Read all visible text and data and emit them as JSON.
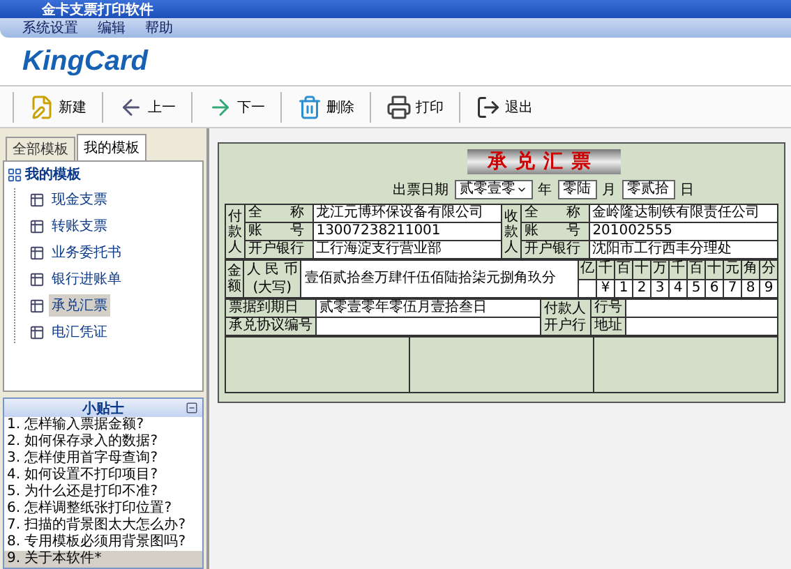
{
  "window": {
    "title": "金卡支票打印软件"
  },
  "menu": [
    {
      "label": "系统设置"
    },
    {
      "label": "编辑"
    },
    {
      "label": "帮助"
    }
  ],
  "logo": "KingCard",
  "toolbar": [
    {
      "label": "新建",
      "kind": "new"
    },
    {
      "label": "上一",
      "kind": "prev"
    },
    {
      "label": "下一",
      "kind": "next"
    },
    {
      "label": "删除",
      "kind": "delete"
    },
    {
      "label": "打印",
      "kind": "print"
    },
    {
      "label": "退出",
      "kind": "exit"
    }
  ],
  "tabs": [
    {
      "label": "全部模板",
      "selected": false
    },
    {
      "label": "我的模板",
      "selected": true
    }
  ],
  "tree": {
    "label": "我的模板",
    "children": [
      {
        "label": "现金支票",
        "selected": false
      },
      {
        "label": "转账支票",
        "selected": false
      },
      {
        "label": "业务委托书",
        "selected": false
      },
      {
        "label": "银行进账单",
        "selected": false
      },
      {
        "label": "承兑汇票",
        "selected": true
      },
      {
        "label": "电汇凭证",
        "selected": false
      }
    ]
  },
  "tips": {
    "title": "小贴士",
    "items": [
      {
        "text": "1. 怎样输入票据金额?",
        "selected": false
      },
      {
        "text": "2. 如何保存录入的数据?",
        "selected": false
      },
      {
        "text": "3. 怎样使用首字母查询?",
        "selected": false
      },
      {
        "text": "4. 如何设置不打印项目?",
        "selected": false
      },
      {
        "text": "5. 为什么还是打印不准?",
        "selected": false
      },
      {
        "text": "6. 怎样调整纸张打印位置?",
        "selected": false
      },
      {
        "text": "7. 扫描的背景图太大怎么办?",
        "selected": false
      },
      {
        "text": "8. 专用模板必须用背景图吗?",
        "selected": false
      },
      {
        "text": "9. 关于本软件*",
        "selected": true
      }
    ]
  },
  "form": {
    "title": "承兑汇票",
    "date": {
      "label": "出票日期",
      "year": "贰零壹零",
      "year_unit": "年",
      "month": "零陆",
      "month_unit": "月",
      "day": "零贰拾",
      "day_unit": "日"
    },
    "payer": {
      "label": "付款人",
      "rows": [
        {
          "label": "全　　称",
          "value": "龙江元博环保设备有限公司"
        },
        {
          "label": "账　　号",
          "value": "13007238211001"
        },
        {
          "label": "开户银行",
          "value": "工行海淀支行营业部"
        }
      ]
    },
    "payee": {
      "label": "收款人",
      "rows": [
        {
          "label": "全　　称",
          "value": "金岭隆达制铁有限责任公司"
        },
        {
          "label": "账　　号",
          "value": "201002555"
        },
        {
          "label": "开户银行",
          "value": "沈阳市工行西丰分理处"
        }
      ]
    },
    "amount": {
      "label": "金额",
      "currency": "人 民 币",
      "note": "(大写)",
      "value": "壹佰贰拾叁万肆仟伍佰陆拾柒元捌角玖分",
      "units": [
        "亿",
        "千",
        "百",
        "十",
        "万",
        "千",
        "百",
        "十",
        "元",
        "角",
        "分"
      ],
      "digits": [
        "¥",
        "1",
        "2",
        "3",
        "4",
        "5",
        "6",
        "7",
        "8",
        "9"
      ]
    },
    "due_label": "票据到期日",
    "due_value": "贰零壹零年零伍月壹拾叁日",
    "agreement_label": "承兑协议编号",
    "bank_label": "付款人开户行",
    "bank_no_label": "行号",
    "address_label": "地址"
  }
}
